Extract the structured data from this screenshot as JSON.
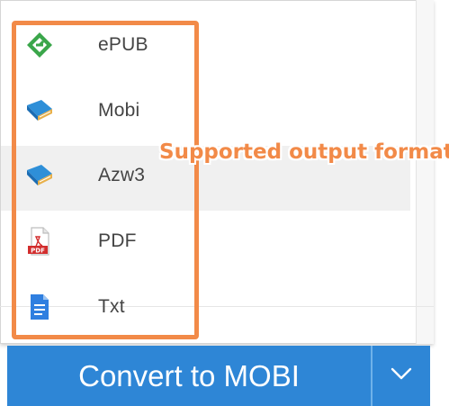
{
  "menu": {
    "items": [
      {
        "label": "ePUB",
        "icon": "epub-icon"
      },
      {
        "label": "Mobi",
        "icon": "mobi-book-icon"
      },
      {
        "label": "Azw3",
        "icon": "azw3-book-icon"
      },
      {
        "label": "PDF",
        "icon": "pdf-file-icon"
      },
      {
        "label": "Txt",
        "icon": "txt-file-icon"
      }
    ],
    "hovered_index": 2
  },
  "annotation": {
    "callout_text": "Supported output format"
  },
  "convert_bar": {
    "button_label": "Convert to MOBI",
    "toggle_icon": "chevron-down-icon"
  },
  "colors": {
    "accent_blue": "#2e86d6",
    "highlight_orange": "#f28a48",
    "epub_green": "#3aa64a",
    "pdf_red": "#d22d2d",
    "txt_blue": "#2f7fe0"
  }
}
